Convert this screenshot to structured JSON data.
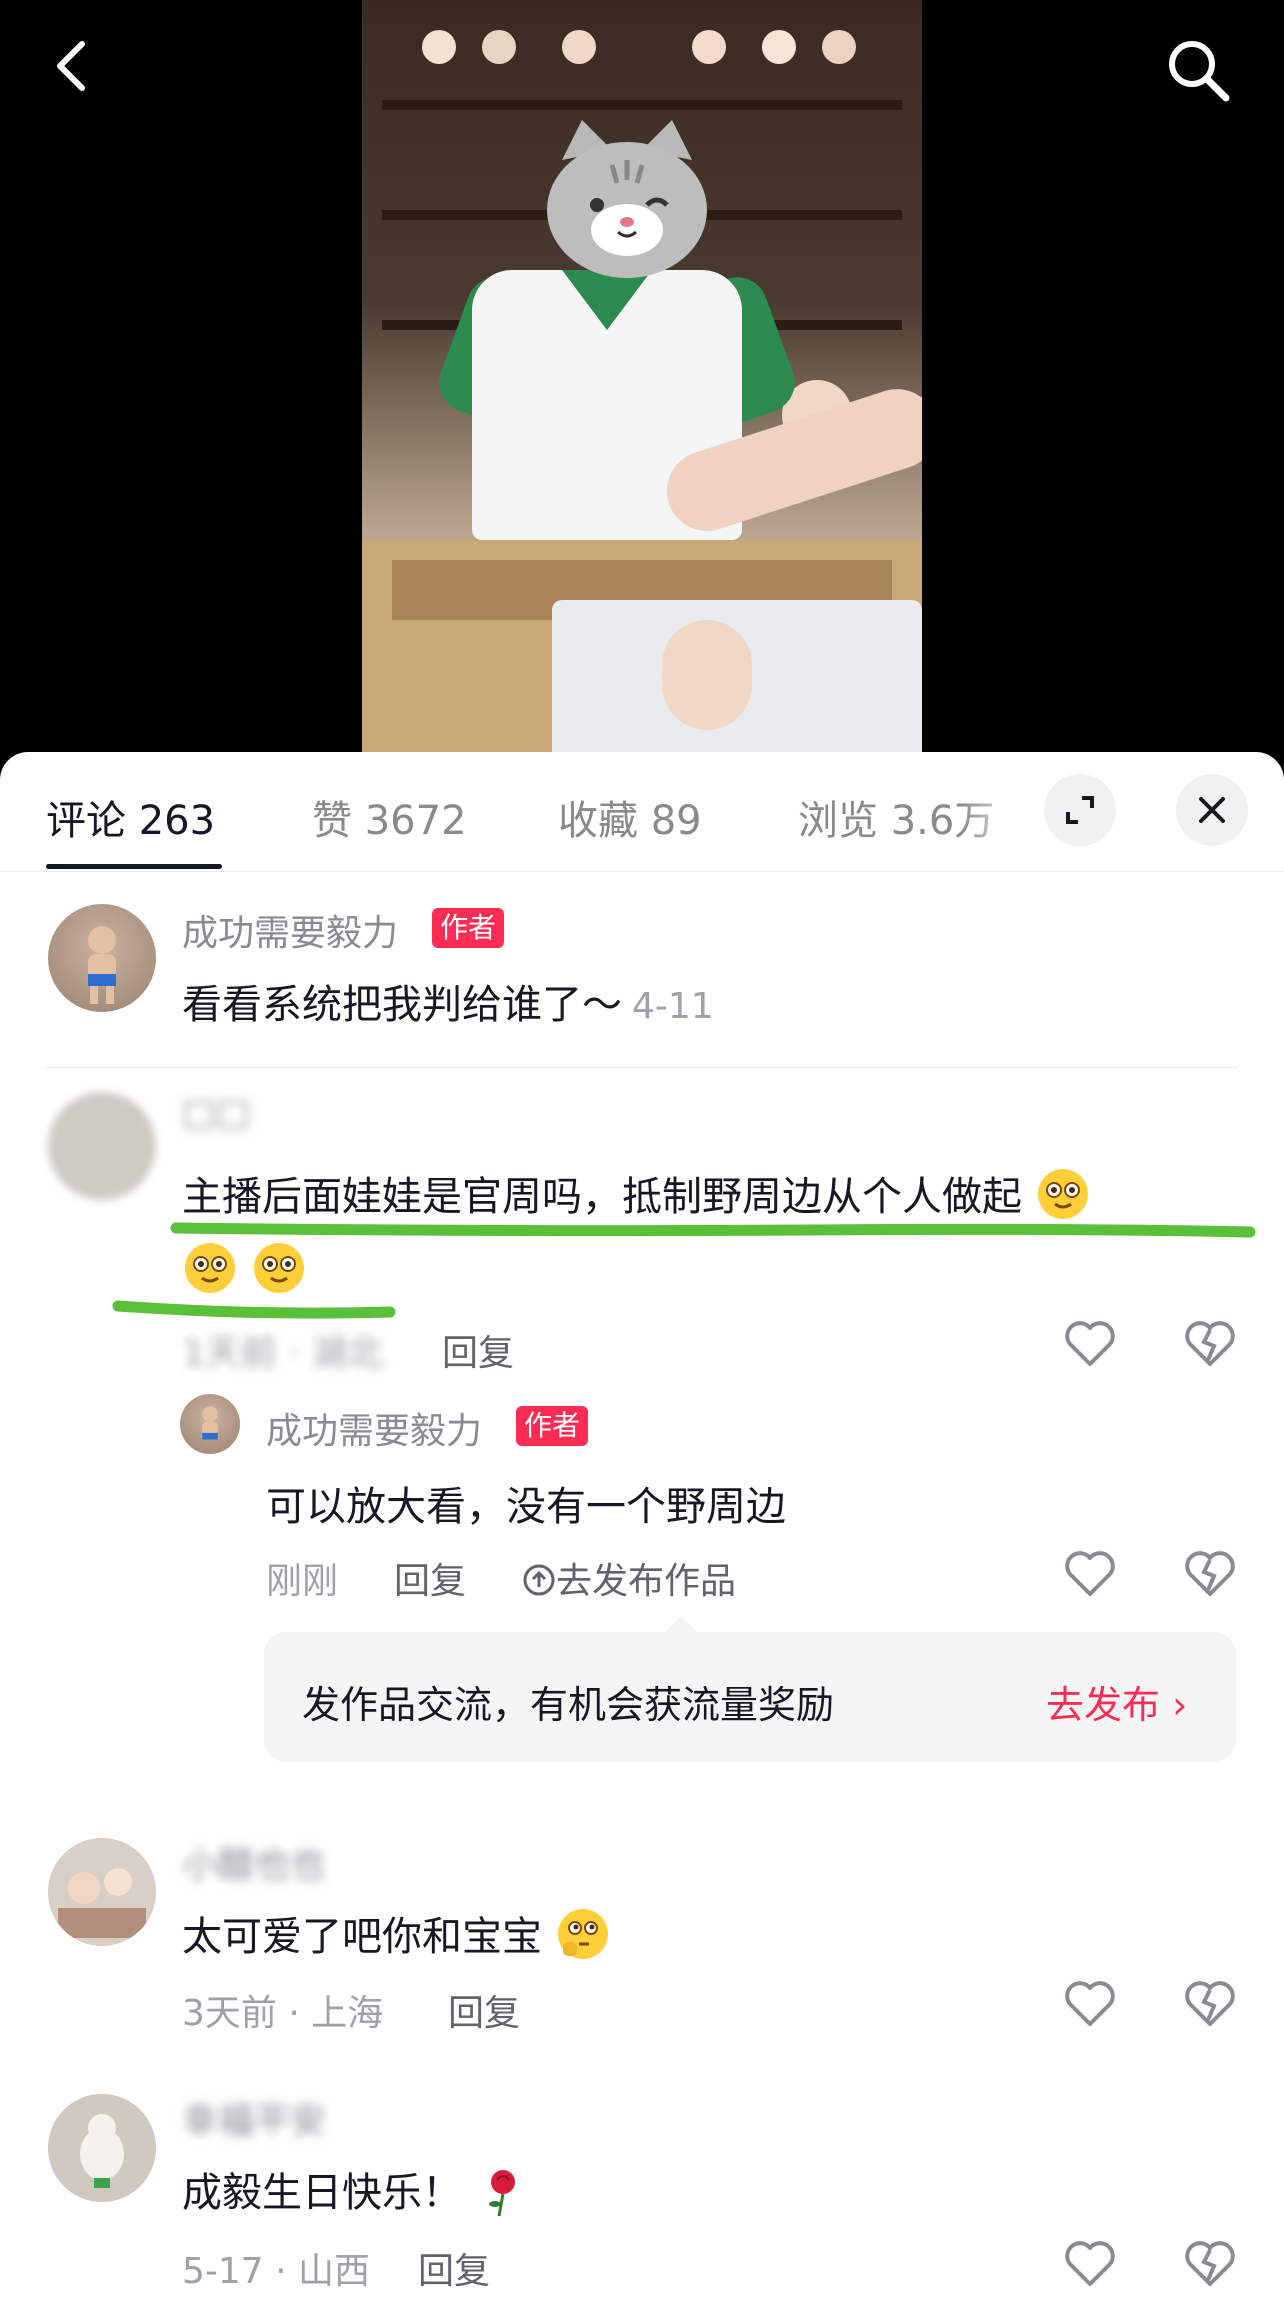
{
  "header": {
    "back_icon": "chevron-left-icon",
    "search_icon": "search-icon"
  },
  "tabs": [
    {
      "label": "评论",
      "count": "263"
    },
    {
      "label": "赞",
      "count": "3672"
    },
    {
      "label": "收藏",
      "count": "89"
    },
    {
      "label": "浏览",
      "count": "3.6万"
    }
  ],
  "comments": [
    {
      "user": "成功需要毅力",
      "badge": "作者",
      "text": "看看系统把我判给谁了～",
      "date": "4-11"
    },
    {
      "user": "□□",
      "text": "主播后面娃娃是官周吗，抵制野周边从个人做起",
      "meta": "1天前 · 湖北",
      "reply_label": "回复",
      "reply": {
        "user": "成功需要毅力",
        "badge": "作者",
        "text": "可以放大看，没有一个野周边",
        "meta": "刚刚",
        "reply_label": "回复",
        "publish_label": "去发布作品"
      }
    },
    {
      "user": "小醋也也",
      "text": "太可爱了吧你和宝宝",
      "meta": "3天前 · 上海",
      "reply_label": "回复"
    },
    {
      "user": "幸福平安",
      "text": "成毅生日快乐！",
      "meta": "5-17 · 山西",
      "reply_label": "回复"
    }
  ],
  "promo": {
    "text": "发作品交流，有机会获流量奖励",
    "link": "去发布",
    "link_arrow": "›"
  },
  "colors": {
    "accent": "#fe2c55",
    "marker": "#5cbf3a"
  }
}
